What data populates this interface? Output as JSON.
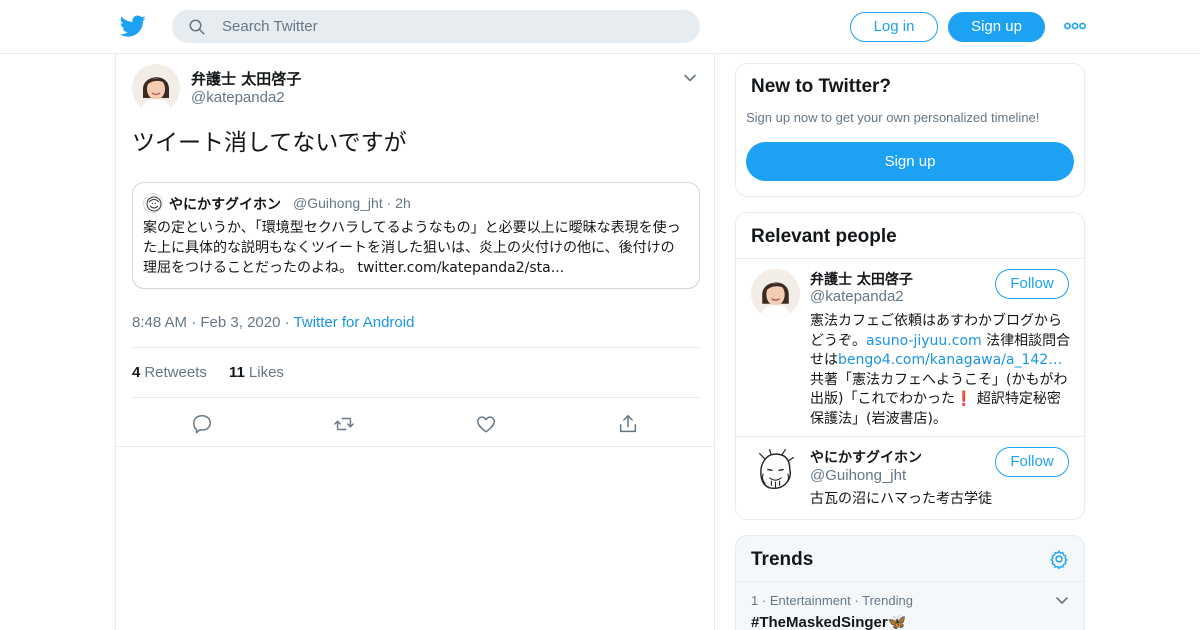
{
  "header": {
    "search_placeholder": "Search Twitter",
    "login_label": "Log in",
    "signup_label": "Sign up"
  },
  "tweet": {
    "author_name": "弁護士 太田啓子",
    "author_handle": "@katepanda2",
    "text": "ツイート消してないですが",
    "quote": {
      "author_name": "やにかすグイホン",
      "author_handle": "@Guihong_jht",
      "separator": "·",
      "time": "2h",
      "text": "案の定というか、「環境型セクハラしてるようなもの」と必要以上に曖昧な表現を使った上に具体的な説明もなくツイートを消した狙いは、炎上の火付けの他に、後付けの理屈をつけることだったのよね。 twitter.com/katepanda2/sta..."
    },
    "time": "8:48 AM",
    "date": "Feb 3, 2020",
    "dot": "·",
    "source": "Twitter for Android",
    "retweets_count": "4",
    "retweets_label": "Retweets",
    "likes_count": "11",
    "likes_label": "Likes",
    "actions": [
      "reply-icon",
      "retweet-icon",
      "like-icon",
      "share-icon"
    ]
  },
  "sidebar": {
    "new": {
      "title": "New to Twitter?",
      "subtitle": "Sign up now to get your own personalized timeline!",
      "button": "Sign up"
    },
    "people": {
      "title": "Relevant people",
      "follow_label": "Follow",
      "items": [
        {
          "name": "弁護士 太田啓子",
          "handle": "@katepanda2",
          "bio_parts": [
            "憲法カフェご依頼はあすわかブログからどうぞ。",
            "asuno-jiyuu.com",
            " 法律相談問合せは",
            "bengo4.com/kanagawa/a_142…",
            " 共著「憲法カフェへようこそ」(かもがわ出版)「これでわかった",
            "❗",
            " 超訳特定秘密保護法」(岩波書店)。"
          ]
        },
        {
          "name": "やにかすグイホン",
          "handle": "@Guihong_jht",
          "bio": "古瓦の沼にハマった考古学徒"
        }
      ]
    },
    "trends": {
      "title": "Trends",
      "items": [
        {
          "rank": "1",
          "category": "Entertainment",
          "status": "Trending",
          "dot": "·",
          "name": "#TheMaskedSinger",
          "emoji": "🦋"
        }
      ]
    }
  },
  "colors": {
    "accent": "#1da1f2",
    "link": "#1b95e0",
    "secondary_text": "#657786",
    "border": "#e6ecf0"
  }
}
